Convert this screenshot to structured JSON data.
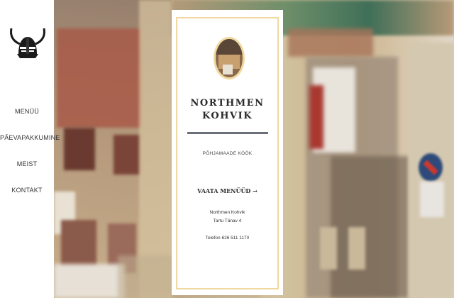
{
  "logo": {
    "icon": "viking-helmet-icon"
  },
  "nav": {
    "items": [
      {
        "label": "MENÜÜ"
      },
      {
        "label": "PÄEVAPAKKUMINE"
      },
      {
        "label": "MEIST"
      },
      {
        "label": "KONTAKT"
      }
    ]
  },
  "card": {
    "brand_line1": "NORTHMEN",
    "brand_line2": "KOHVIK",
    "tagline": "PÕHJAMAADE KÖÖK",
    "cta": "VAATA MENÜÜD →",
    "address_name": "Northmen Kohvik",
    "address_street": "Tartu Tänav 4",
    "phone": "Telefon 626 511 1170"
  },
  "colors": {
    "accent_border": "#f0d9a0",
    "rule": "#6b6f78"
  }
}
